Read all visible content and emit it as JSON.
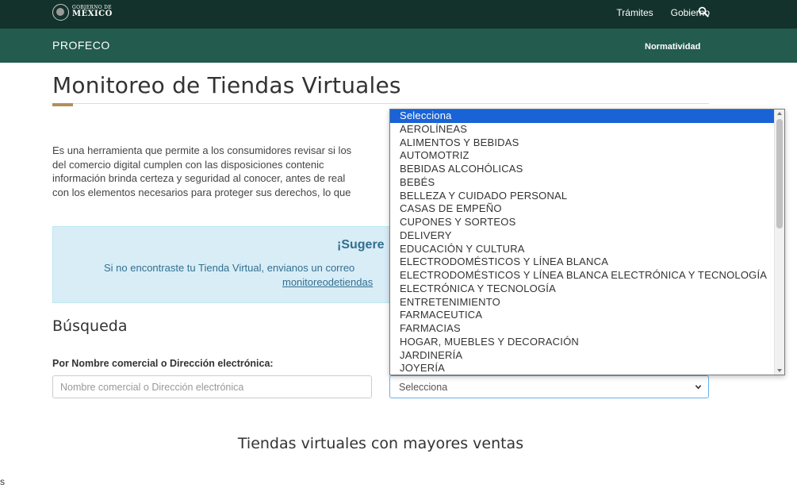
{
  "header": {
    "logo_small": "GOBIERNO DE",
    "logo_big": "MÉXICO",
    "nav": [
      "Trámites",
      "Gobierno"
    ]
  },
  "subheader": {
    "brand": "PROFECO",
    "link": "Normatividad"
  },
  "page": {
    "title": "Monitoreo de Tiendas Virtuales",
    "intro_lines": [
      "Es una herramienta que permite a los consumidores revisar si los",
      "del comercio digital cumplen con las disposiciones contenic",
      "información brinda certeza y seguridad al conocer, antes de real",
      "con los elementos necesarios para proteger sus derechos, lo que"
    ],
    "suggestion": {
      "title": "¡Sugere",
      "text": "Si no encontraste tu Tienda Virtual, envianos un correo",
      "link": "monitoreodetiendas"
    },
    "search": {
      "heading": "Búsqueda",
      "label": "Por Nombre comercial o Dirección electrónica:",
      "name_placeholder": "Nombre comercial o Dirección electrónica",
      "category_selected": "Selecciona"
    },
    "top_stores_heading": "Tiendas virtuales con mayores ventas",
    "edge_fragment": "s"
  },
  "dropdown": {
    "options": [
      "Selecciona",
      "AEROLÍNEAS",
      "ALIMENTOS Y BEBIDAS",
      "AUTOMOTRIZ",
      "BEBIDAS ALCOHÓLICAS",
      "BEBÉS",
      "BELLEZA Y CUIDADO PERSONAL",
      "CASAS DE EMPEÑO",
      "CUPONES Y SORTEOS",
      "DELIVERY",
      "EDUCACIÓN Y CULTURA",
      "ELECTRODOMÉSTICOS Y LÍNEA BLANCA",
      "ELECTRODOMÉSTICOS Y LÍNEA BLANCA ELECTRÓNICA Y TECNOLOGÍA",
      "ELECTRÓNICA Y TECNOLOGÍA",
      "ENTRETENIMIENTO",
      "FARMACEUTICA",
      "FARMACIAS",
      "HOGAR, MUEBLES Y DECORACIÓN",
      "JARDINERÍA",
      "JOYERÍA"
    ],
    "highlighted_index": 0
  },
  "colors": {
    "header_bg": "#13322b",
    "subheader_bg": "#235b4e",
    "accent_gold": "#b38e5d",
    "alert_bg": "#d9edf7",
    "alert_text": "#31708f",
    "highlight": "#1a63d6"
  },
  "icons": {
    "search": "search-icon",
    "select": "chevron-down-icon",
    "logo": "government-seal-icon"
  }
}
